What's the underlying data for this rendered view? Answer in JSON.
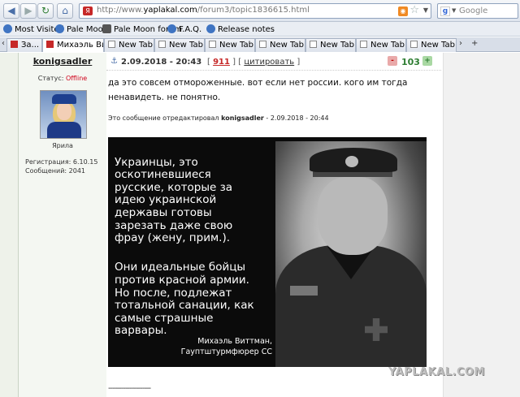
{
  "browser": {
    "url_prefix": "http://www.",
    "url_domain": "yaplakal.com",
    "url_path": "/forum3/topic1836615.html",
    "search_placeholder": "Google"
  },
  "bookmarks": [
    {
      "label": "Most Visited",
      "icon": "most-visited-icon"
    },
    {
      "label": "Pale Moon",
      "icon": "pale-moon-icon"
    },
    {
      "label": "Pale Moon forum",
      "icon": "forum-icon"
    },
    {
      "label": "F.A.Q.",
      "icon": "faq-icon"
    },
    {
      "label": "Release notes",
      "icon": "release-notes-icon"
    }
  ],
  "tabs": [
    {
      "label": "За..."
    },
    {
      "label": "Михаэль Витт..."
    },
    {
      "label": "New Tab"
    },
    {
      "label": "New Tab"
    },
    {
      "label": "New Tab"
    },
    {
      "label": "New Tab"
    },
    {
      "label": "New Tab"
    },
    {
      "label": "New Tab"
    },
    {
      "label": "New Tab"
    }
  ],
  "post": {
    "author": "konigsadler",
    "status_label": "Статус:",
    "status_value": "Offline",
    "avatar_caption": "Ярила",
    "registration": "Регистрация: 6.10.15",
    "messages": "Сообщений: 2041",
    "date": "2.09.2018 - 20:43",
    "number_open": "[",
    "number": "911",
    "number_sep": "] [",
    "quote_label": "цитировать",
    "number_close": "]",
    "vote_minus": "-",
    "rating": "103",
    "vote_plus": "+",
    "text": "да это совсем отмороженные. вот если нет россии. кого им тогда ненавидеть. не понятно.",
    "edited_prefix": "Это сообщение отредактировал",
    "edited_user": "konigsadler",
    "edited_date": "- 2.09.2018 - 20:44",
    "meme_para1": "Украинцы, это\nоскотиневшиеся\nрусские, которые за\nидею украинской\nдержавы готовы\nзарезать даже свою\nфрау (жену, прим.).",
    "meme_para2": "Они идеальные бойцы\nпротив красной армии.\nНо после, подлежат\nтотальной санации, как\nсамые страшные\nварвары.",
    "meme_sig1": "Михаэль Виттман,",
    "meme_sig2": "Гауптштурмфюрер СС",
    "watermark": "YAPLAKAL.COM",
    "divider": "--------------------"
  }
}
